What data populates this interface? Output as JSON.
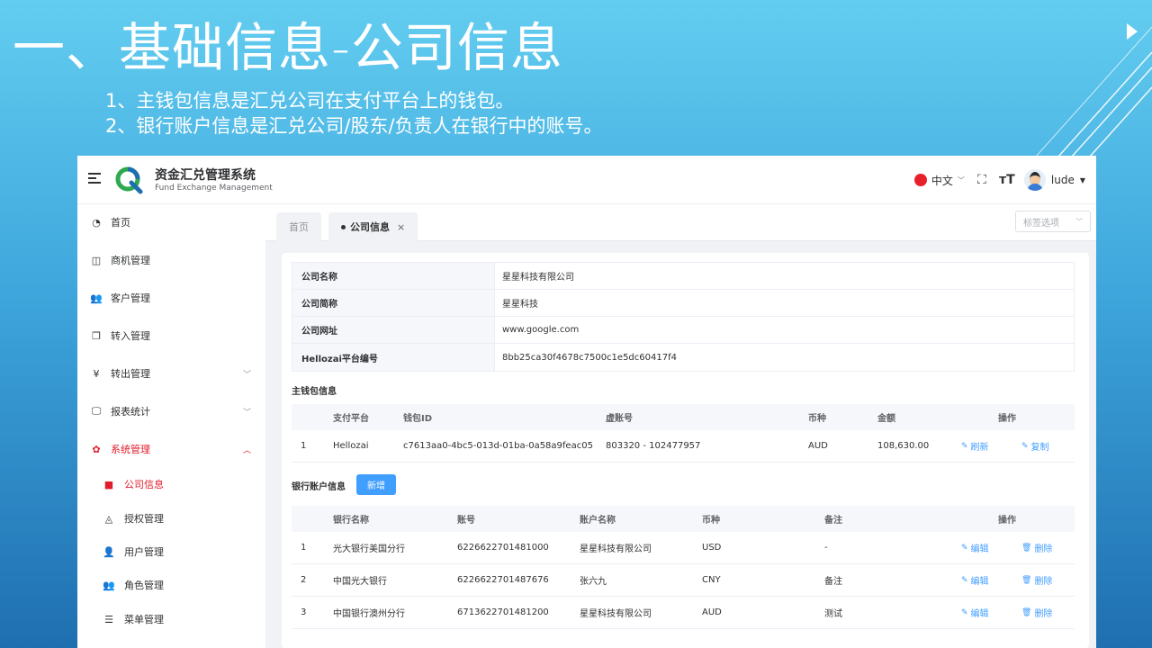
{
  "slide": {
    "title": "一、基础信息-公司信息",
    "points": [
      "1、主钱包信息是汇兑公司在支付平台上的钱包。",
      "2、银行账户信息是汇兑公司/股东/负责人在银行中的账号。"
    ]
  },
  "header": {
    "brand_title": "资金汇兑管理系统",
    "brand_subtitle": "Fund Exchange Management",
    "language": "中文",
    "username": "lude"
  },
  "sidebar": {
    "items": [
      {
        "label": "首页",
        "icon": "dashboard-icon"
      },
      {
        "label": "商机管理",
        "icon": "book-icon"
      },
      {
        "label": "客户管理",
        "icon": "users-icon"
      },
      {
        "label": "转入管理",
        "icon": "copy-icon"
      },
      {
        "label": "转出管理",
        "icon": "yen-icon"
      },
      {
        "label": "报表统计",
        "icon": "monitor-icon"
      },
      {
        "label": "系统管理",
        "icon": "gear-icon"
      }
    ],
    "sub_items": [
      {
        "label": "公司信息",
        "icon": "folder-icon"
      },
      {
        "label": "授权管理",
        "icon": "shield-icon"
      },
      {
        "label": "用户管理",
        "icon": "user-icon"
      },
      {
        "label": "角色管理",
        "icon": "users-icon"
      },
      {
        "label": "菜单管理",
        "icon": "list-icon"
      }
    ]
  },
  "tabs": {
    "home": "首页",
    "active": "公司信息",
    "close": "×",
    "select_placeholder": "标签选项"
  },
  "company": {
    "rows": [
      {
        "label": "公司名称",
        "value": "星星科技有限公司"
      },
      {
        "label": "公司简称",
        "value": "星星科技"
      },
      {
        "label": "公司网址",
        "value": "www.google.com"
      },
      {
        "label": "Hellozai平台编号",
        "value": "8bb25ca30f4678c7500c1e5dc60417f4"
      }
    ]
  },
  "wallet": {
    "title": "主钱包信息",
    "headers": [
      "支付平台",
      "钱包ID",
      "虚账号",
      "币种",
      "金额",
      "操作"
    ],
    "rows": [
      {
        "index": "1",
        "platform": "Hellozai",
        "wallet_id": "c7613aa0-4bc5-013d-01ba-0a58a9feac05",
        "virtual_account": "803320 - 102477957",
        "currency": "AUD",
        "amount": "108,630.00",
        "action1": "刷新",
        "action2": "复制"
      }
    ]
  },
  "bank": {
    "title": "银行账户信息",
    "add_label": "新增",
    "headers": [
      "银行名称",
      "账号",
      "账户名称",
      "币种",
      "备注",
      "操作"
    ],
    "rows": [
      {
        "index": "1",
        "bank": "光大银行美国分行",
        "account": "6226622701481000",
        "name": "星星科技有限公司",
        "currency": "USD",
        "note": "-",
        "edit": "编辑",
        "delete": "删除"
      },
      {
        "index": "2",
        "bank": "中国光大银行",
        "account": "6226622701487676",
        "name": "张六九",
        "currency": "CNY",
        "note": "备注",
        "edit": "编辑",
        "delete": "删除"
      },
      {
        "index": "3",
        "bank": "中国银行澳州分行",
        "account": "6713622701481200",
        "name": "星星科技有限公司",
        "currency": "AUD",
        "note": "测试",
        "edit": "编辑",
        "delete": "删除"
      }
    ]
  }
}
